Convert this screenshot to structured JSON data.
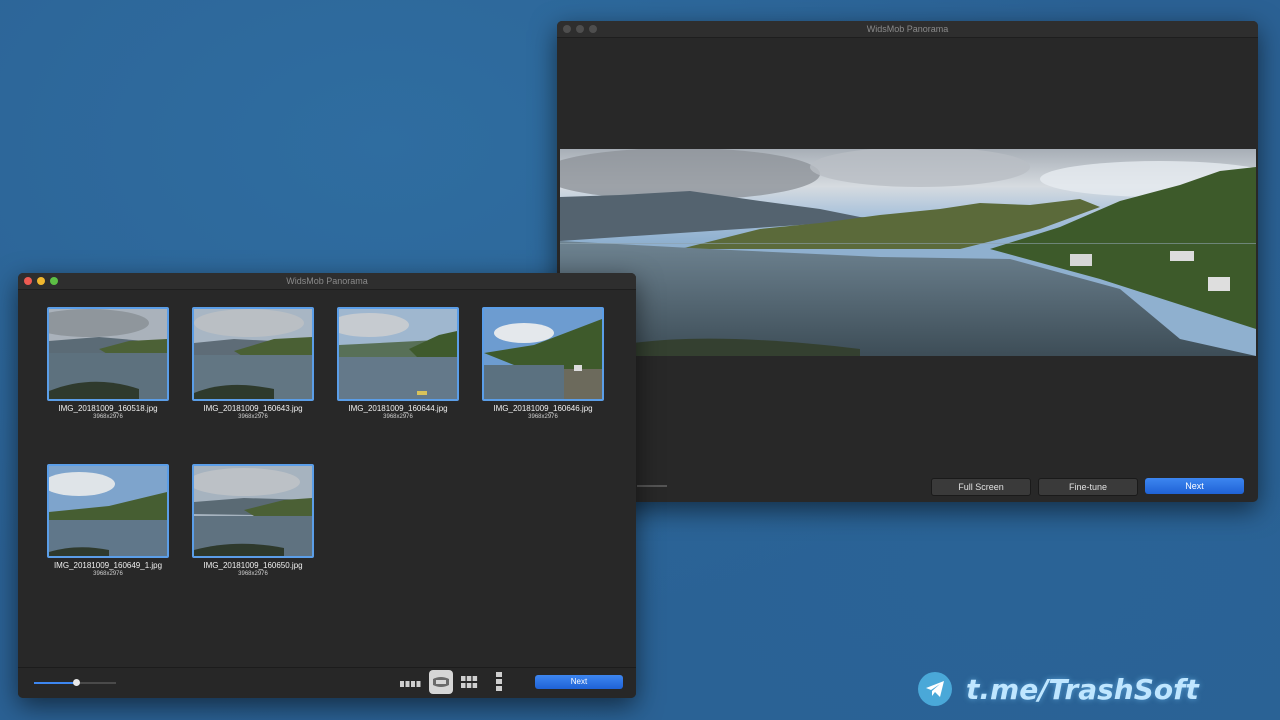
{
  "back_window": {
    "title": "WidsMob Panorama",
    "buttons": {
      "full_screen": "Full Screen",
      "fine_tune": "Fine-tune",
      "next": "Next"
    }
  },
  "front_window": {
    "title": "WidsMob Panorama",
    "images": [
      {
        "name": "IMG_20181009_160518.jpg",
        "size": "3968x2976"
      },
      {
        "name": "IMG_20181009_160643.jpg",
        "size": "3968x2976"
      },
      {
        "name": "IMG_20181009_160644.jpg",
        "size": "3968x2976"
      },
      {
        "name": "IMG_20181009_160646.jpg",
        "size": "3968x2976"
      },
      {
        "name": "IMG_20181009_160649_1.jpg",
        "size": "3968x2976"
      },
      {
        "name": "IMG_20181009_160650.jpg",
        "size": "3968x2976"
      }
    ],
    "zoom_level": 0.52,
    "view_modes": [
      "small-thumbnails",
      "panorama-layout",
      "grid",
      "vertical-strip"
    ],
    "next_label": "Next"
  },
  "watermark": {
    "text": "t.me/TrashSoft"
  },
  "colors": {
    "accent": "#2a6fe6",
    "selection_border": "#5b9ee8",
    "desktop": "#2b6194"
  }
}
